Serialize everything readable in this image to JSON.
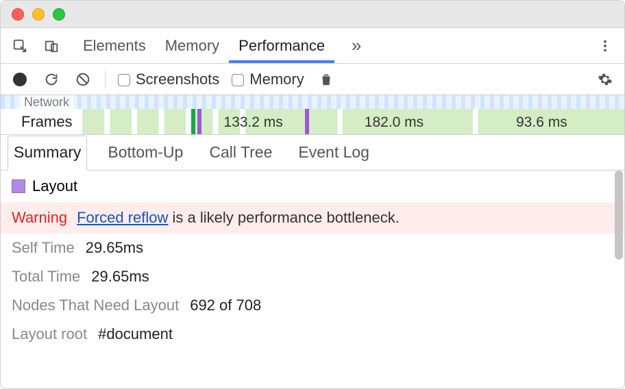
{
  "mainnav": {
    "tabs": [
      "Elements",
      "Memory",
      "Performance"
    ],
    "active_index": 2
  },
  "toolbar": {
    "screenshots_label": "Screenshots",
    "memory_label": "Memory"
  },
  "timeline": {
    "net_label": "Network",
    "row_label": "Frames",
    "frame_times": [
      "133.2 ms",
      "182.0 ms",
      "93.6 ms"
    ]
  },
  "subtabs": {
    "items": [
      "Summary",
      "Bottom-Up",
      "Call Tree",
      "Event Log"
    ],
    "active_index": 0
  },
  "event": {
    "name": "Layout",
    "color": "#b18ae6",
    "warning_label": "Warning",
    "warning_link_text": "Forced reflow",
    "warning_text_tail": " is a likely performance bottleneck.",
    "rows": [
      {
        "k": "Self Time",
        "v": "29.65ms"
      },
      {
        "k": "Total Time",
        "v": "29.65ms"
      },
      {
        "k": "Nodes That Need Layout",
        "v": "692 of 708"
      },
      {
        "k": "Layout root",
        "v": "#document",
        "doc": true
      }
    ]
  }
}
